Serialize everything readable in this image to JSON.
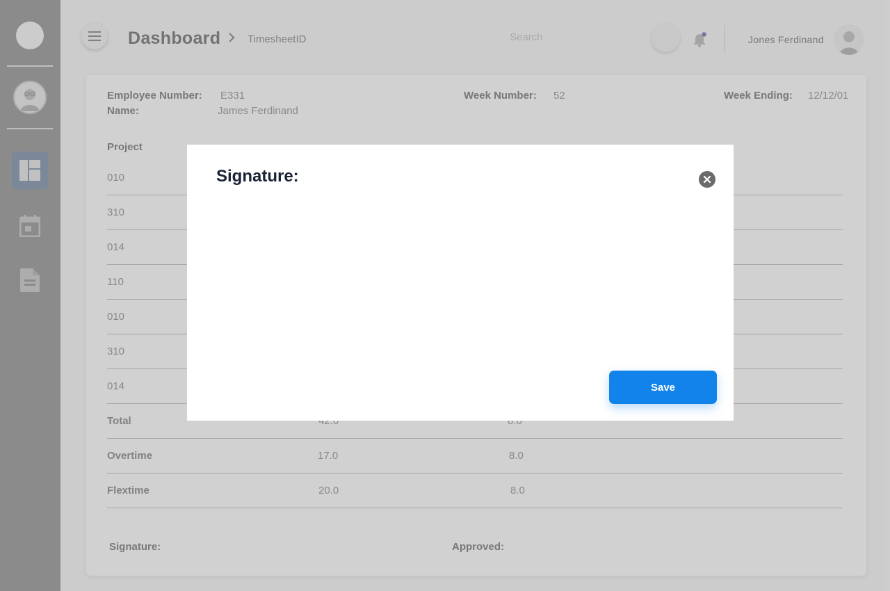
{
  "header": {
    "title": "Dashboard",
    "breadcrumb": "TimesheetID",
    "search_placeholder": "Search",
    "user_name": "Jones Ferdinand"
  },
  "sidebar": {
    "items": [
      {
        "name": "dashboard",
        "icon": "dashboard-icon",
        "active": true
      },
      {
        "name": "calendar",
        "icon": "calendar-icon",
        "active": false
      },
      {
        "name": "document",
        "icon": "document-icon",
        "active": false
      }
    ]
  },
  "timesheet": {
    "employee_number_label": "Employee Number:",
    "employee_number": "E331",
    "name_label": "Name:",
    "name": "James Ferdinand",
    "week_number_label": "Week Number:",
    "week_number": "52",
    "week_ending_label": "Week Ending:",
    "week_ending": "12/12/01",
    "project_header": "Project",
    "projects": [
      "010",
      "310",
      "014",
      "110",
      "010",
      "310",
      "014"
    ],
    "summary": [
      {
        "label": "Total",
        "total": "42.0",
        "day": "8.0"
      },
      {
        "label": "Overtime",
        "total": "17.0",
        "day": "8.0"
      },
      {
        "label": "Flextime",
        "total": "20.0",
        "day": "8.0"
      }
    ],
    "signature_label": "Signature:",
    "approved_label": "Approved:"
  },
  "modal": {
    "title": "Signature:",
    "save_label": "Save"
  },
  "colors": {
    "accent": "#1183ea",
    "sidebar": "#a6a6a6",
    "modal_title": "#1a2235"
  }
}
